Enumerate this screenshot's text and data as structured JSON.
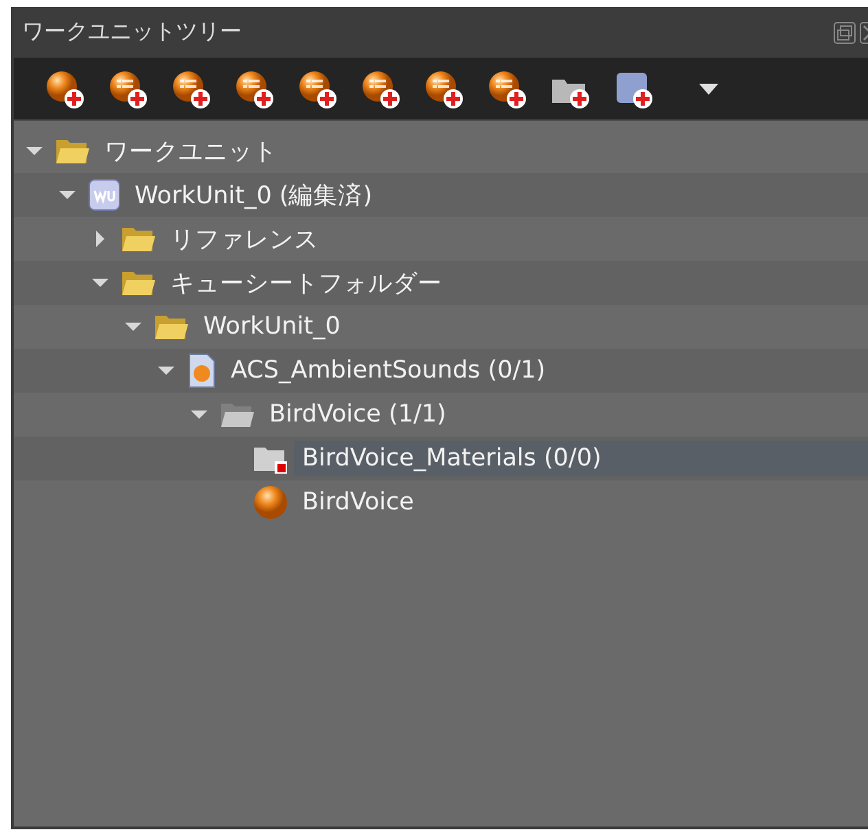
{
  "panel": {
    "title": "ワークユニットツリー"
  },
  "tree": [
    {
      "label": "ワークユニット",
      "kind": "folder",
      "expanded": true,
      "selected": false,
      "children": [
        {
          "label": "WorkUnit_0 (編集済)",
          "kind": "workunit",
          "expanded": true,
          "selected": false,
          "children": [
            {
              "label": "リファレンス",
              "kind": "folder",
              "expanded": false,
              "selected": false
            },
            {
              "label": "キューシートフォルダー",
              "kind": "folder",
              "expanded": true,
              "selected": false,
              "children": [
                {
                  "label": "WorkUnit_0",
                  "kind": "folder",
                  "expanded": true,
                  "selected": false,
                  "children": [
                    {
                      "label": "ACS_AmbientSounds (0/1)",
                      "kind": "cuesheet",
                      "expanded": true,
                      "selected": false,
                      "children": [
                        {
                          "label": "BirdVoice (1/1)",
                          "kind": "category",
                          "expanded": true,
                          "selected": false,
                          "children": [
                            {
                              "label": "BirdVoice_Materials (0/0)",
                              "kind": "materials",
                              "selected": true
                            },
                            {
                              "label": "BirdVoice",
                              "kind": "cue",
                              "selected": false
                            }
                          ]
                        }
                      ]
                    }
                  ]
                }
              ]
            }
          ]
        }
      ]
    }
  ]
}
